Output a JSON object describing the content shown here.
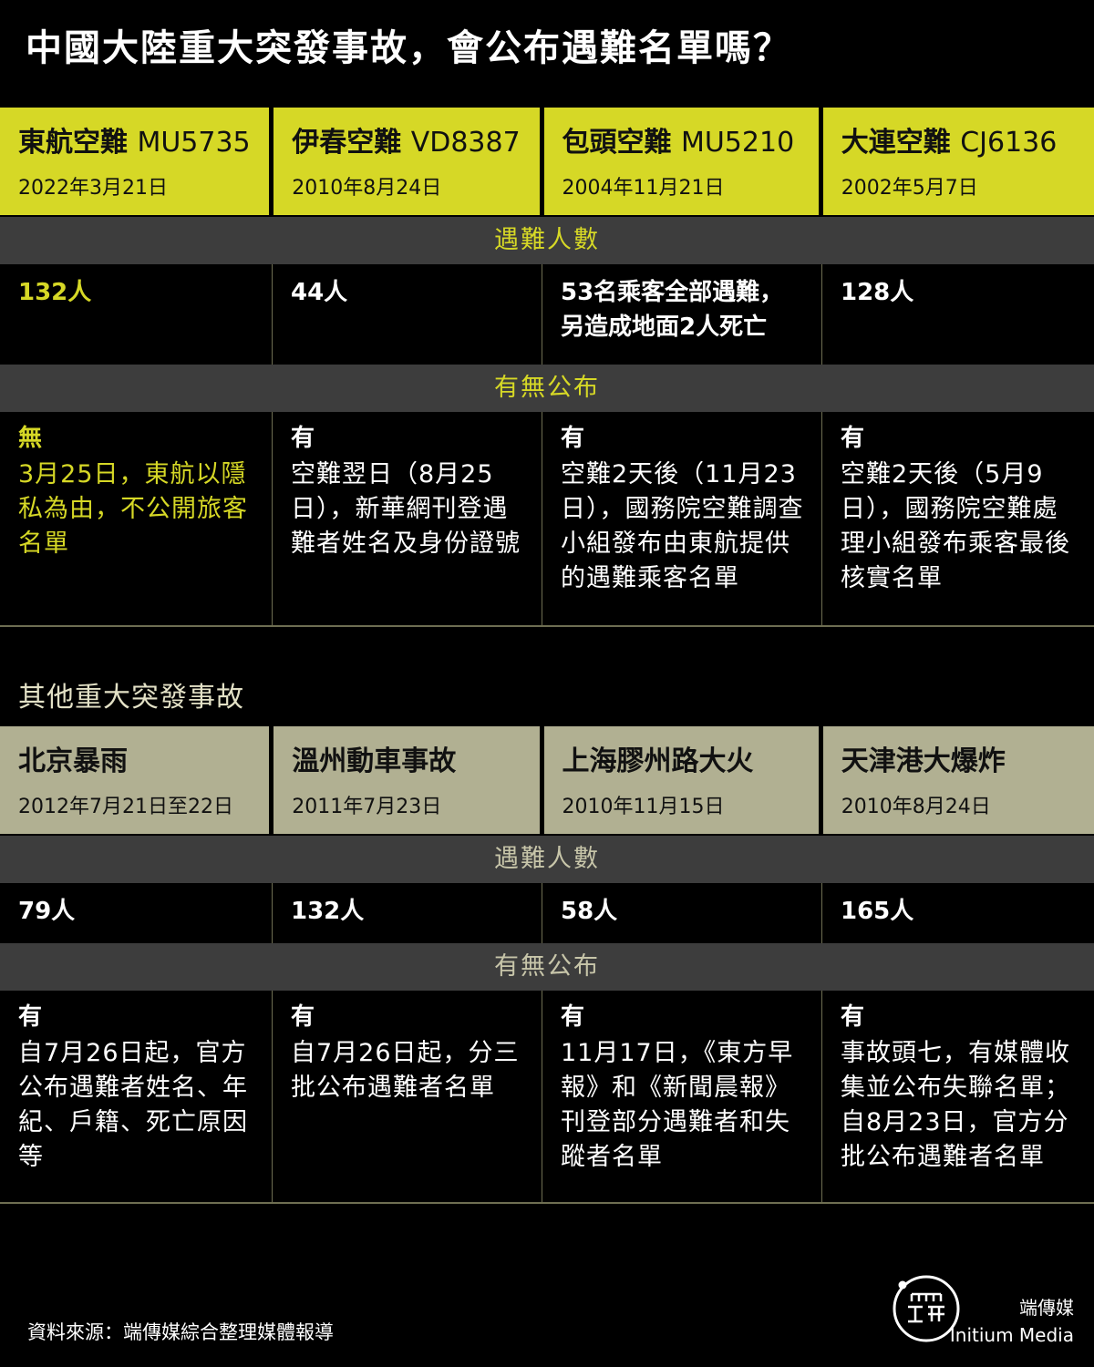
{
  "title": "中國大陸重大突發事故，會公布遇難名單嗎？",
  "section_labels": {
    "victims": "遇難人數",
    "published": "有無公布"
  },
  "air": [
    {
      "name": "東航空難",
      "code": "MU5735",
      "date": "2022年3月21日",
      "count": "132人",
      "yes": "無",
      "desc": "3月25日，東航以隱私為由，不公開旅客名單"
    },
    {
      "name": "伊春空難",
      "code": "VD8387",
      "date": "2010年8月24日",
      "count": "44人",
      "yes": "有",
      "desc": "空難翌日（8月25日），新華網刊登遇難者姓名及身份證號"
    },
    {
      "name": "包頭空難",
      "code": "MU5210",
      "date": "2004年11月21日",
      "count": "53名乘客全部遇難，另造成地面2人死亡",
      "yes": "有",
      "desc": "空難2天後（11月23日），國務院空難調查小組發布由東航提供的遇難乘客名單"
    },
    {
      "name": "大連空難",
      "code": "CJ6136",
      "date": "2002年5月7日",
      "count": "128人",
      "yes": "有",
      "desc": "空難2天後（5月9日），國務院空難處理小組發布乘客最後核實名單"
    }
  ],
  "other_title": "其他重大突發事故",
  "other": [
    {
      "name": "北京暴雨",
      "date": "2012年7月21日至22日",
      "count": "79人",
      "yes": "有",
      "desc": "自7月26日起，官方公布遇難者姓名、年紀、戶籍、死亡原因等"
    },
    {
      "name": "溫州動車事故",
      "date": "2011年7月23日",
      "count": "132人",
      "yes": "有",
      "desc": "自7月26日起，分三批公布遇難者名單"
    },
    {
      "name": "上海膠州路大火",
      "date": "2010年11月15日",
      "count": "58人",
      "yes": "有",
      "desc": "11月17日，《東方早報》和《新聞晨報》刊登部分遇難者和失蹤者名單"
    },
    {
      "name": "天津港大爆炸",
      "date": "2010年8月24日",
      "count": "165人",
      "yes": "有",
      "desc": "事故頭七，有媒體收集並公布失聯名單；自8月23日，官方分批公布遇難者名單"
    }
  ],
  "source": "資料來源：端傳媒綜合整理媒體報導",
  "brand": {
    "cn": "端傳媒",
    "en": "Initium Media"
  },
  "colors": {
    "accent_yellow": "#d6d826",
    "header_gray": "#b1b092",
    "band_gray": "#3d3d3d"
  }
}
